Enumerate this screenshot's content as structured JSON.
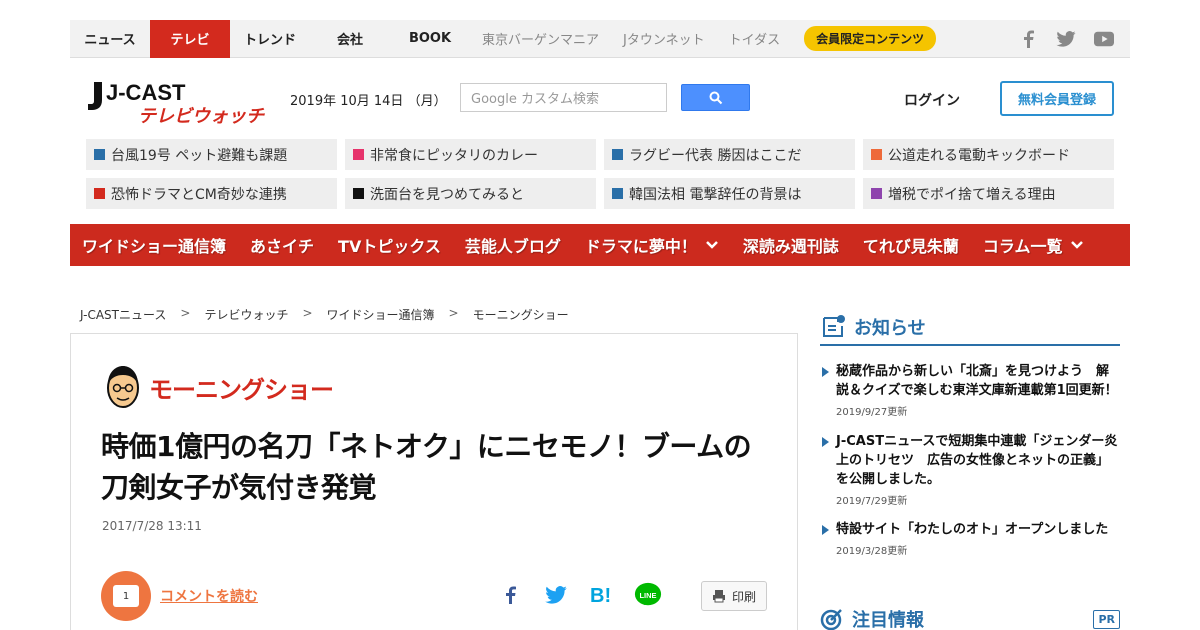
{
  "topnav": {
    "items": [
      "ニュース",
      "テレビ",
      "トレンド",
      "会社",
      "BOOK"
    ],
    "sub_items": [
      "東京バーゲンマニア",
      "Jタウンネット",
      "トイダス"
    ],
    "member_label": "会員限定コンテンツ",
    "social_icons": [
      "facebook-icon",
      "twitter-icon",
      "youtube-icon"
    ]
  },
  "header": {
    "logo_top": "J-CAST",
    "logo_bottom": "テレビウォッチ",
    "date": "2019年 10月 14日 （月）",
    "search_placeholder": "Google カスタム検索",
    "login_label": "ログイン",
    "register_label": "無料会員登録"
  },
  "topics": [
    {
      "label": "台風19号 ペット避難も課題",
      "color": "#2a6fa8"
    },
    {
      "label": "非常食にピッタリのカレー",
      "color": "#e6336b"
    },
    {
      "label": "ラグビー代表 勝因はここだ",
      "color": "#2a6fa8"
    },
    {
      "label": "公道走れる電動キックボード",
      "color": "#ee6a3a"
    },
    {
      "label": "恐怖ドラマとCM奇妙な連携",
      "color": "#d32a1e"
    },
    {
      "label": "洗面台を見つめてみると",
      "color": "#111111"
    },
    {
      "label": "韓国法相 電撃辞任の背景は",
      "color": "#2a6fa8"
    },
    {
      "label": "増税でポイ捨て増える理由",
      "color": "#8e44ad"
    }
  ],
  "rednav": {
    "items": [
      "ワイドショー通信簿",
      "あさイチ",
      "TVトピックス",
      "芸能人ブログ",
      "ドラマに夢中！",
      "深読み週刊誌",
      "てれび見朱蘭",
      "コラム一覧"
    ]
  },
  "breadcrumb": {
    "items": [
      "J-CASTニュース",
      "テレビウォッチ",
      "ワイドショー通信簿",
      "モーニングショー"
    ],
    "separator": ">"
  },
  "article": {
    "program": "モーニングショー",
    "headline": "時価1億円の名刀「ネトオク」にニセモノ！ブームの刀剣女子が気付き発覚",
    "timestamp": "2017/7/28 13:11",
    "comment_count": "1",
    "comment_label": "コメントを読む",
    "print_label": "印刷"
  },
  "sidebar": {
    "notice_title": "お知らせ",
    "news": [
      {
        "title": "秘蔵作品から新しい「北斎」を見つけよう　解説＆クイズで楽しむ東洋文庫新連載第1回更新！",
        "date": "2019/9/27更新"
      },
      {
        "title": "J-CASTニュースで短期集中連載「ジェンダー炎上のトリセツ　広告の女性像とネットの正義」を公開しました。",
        "date": "2019/7/29更新"
      },
      {
        "title": "特設サイト「わたしのオト」オープンしました",
        "date": "2019/3/28更新"
      }
    ],
    "featured_title": "注目情報",
    "pr_label": "PR"
  }
}
